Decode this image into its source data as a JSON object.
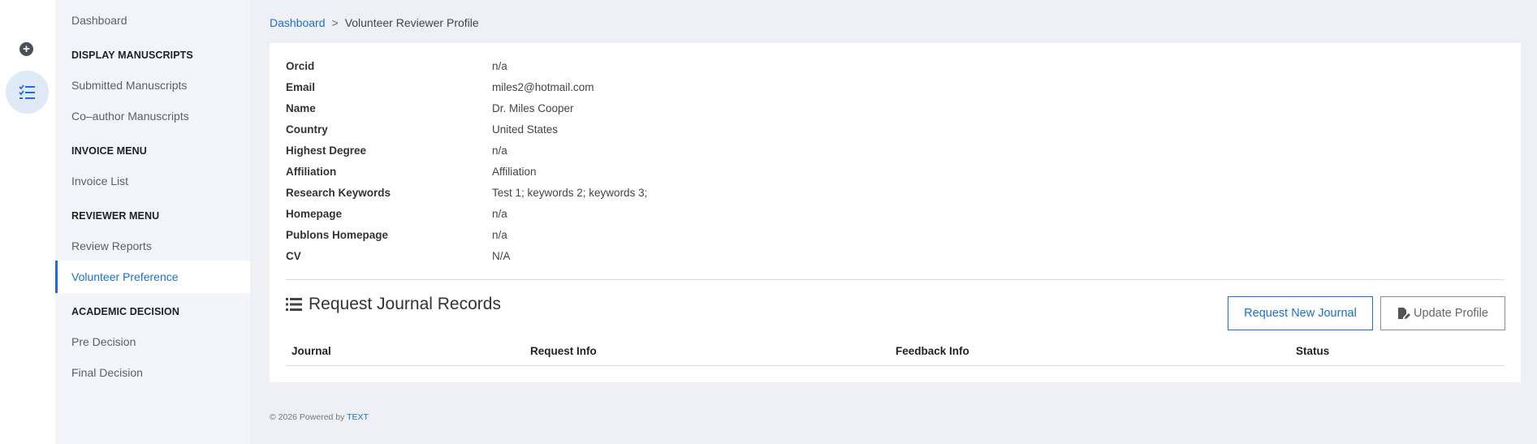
{
  "sidebar": {
    "dashboard": "Dashboard",
    "sections": {
      "display_manuscripts": "DISPLAY MANUSCRIPTS",
      "invoice_menu": "INVOICE MENU",
      "reviewer_menu": "REVIEWER MENU",
      "academic_decision": "ACADEMIC DECISION"
    },
    "items": {
      "submitted": "Submitted Manuscripts",
      "coauthor": "Co–author Manuscripts",
      "invoice_list": "Invoice List",
      "review_reports": "Review Reports",
      "volunteer_preference": "Volunteer Preference",
      "pre_decision": "Pre Decision",
      "final_decision": "Final Decision"
    }
  },
  "breadcrumb": {
    "root": "Dashboard",
    "separator": ">",
    "current": "Volunteer Reviewer Profile"
  },
  "profile": [
    {
      "label": "Orcid",
      "value": "n/a"
    },
    {
      "label": "Email",
      "value": "miles2@hotmail.com"
    },
    {
      "label": "Name",
      "value": "Dr. Miles Cooper"
    },
    {
      "label": "Country",
      "value": "United States"
    },
    {
      "label": "Highest Degree",
      "value": "n/a"
    },
    {
      "label": "Affiliation",
      "value": "Affiliation"
    },
    {
      "label": "Research Keywords",
      "value": "Test 1; keywords 2; keywords 3;"
    },
    {
      "label": "Homepage",
      "value": "n/a"
    },
    {
      "label": "Publons Homepage",
      "value": "n/a"
    },
    {
      "label": "CV",
      "value": "N/A"
    }
  ],
  "records": {
    "title": "Request Journal Records",
    "request_button": "Request New Journal",
    "update_button": "Update Profile",
    "columns": [
      "Journal",
      "Request Info",
      "Feedback Info",
      "Status"
    ]
  },
  "footer": {
    "text": "© 2026 Powered by",
    "brand": "TEXT"
  },
  "colors": {
    "accent": "#1a6fd4",
    "page_background": "#eef0f6",
    "sidebar_background": "#f4f5fa"
  }
}
